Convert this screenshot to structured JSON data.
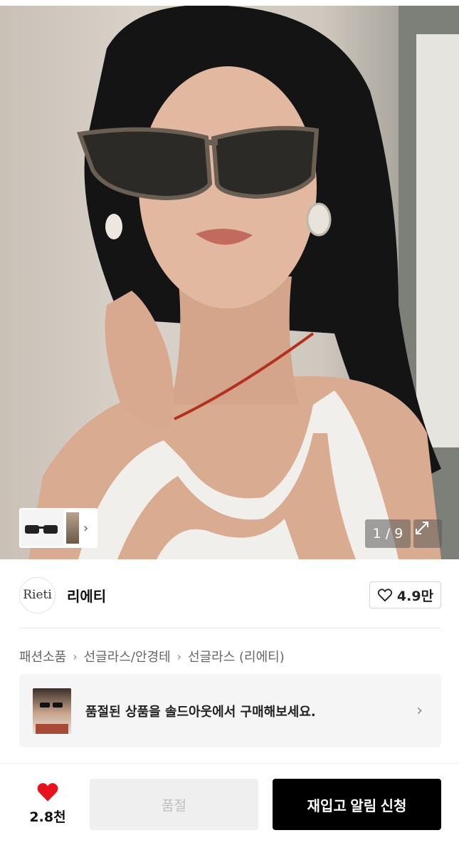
{
  "gallery": {
    "counter": "1 / 9"
  },
  "brand": {
    "logo_text": "Rieti",
    "name": "리에티",
    "like_count": "4.9만"
  },
  "breadcrumb": [
    "패션소품",
    "선글라스/안경테",
    "선글라스 (리에티)"
  ],
  "soldout_banner": {
    "text": "품절된 상품을 솔드아웃에서 구매해보세요."
  },
  "bottom_bar": {
    "wish_count": "2.8천",
    "soldout_label": "품절",
    "restock_label": "재입고 알림 신청"
  },
  "colors": {
    "accent_heart": "#e8121c",
    "primary_button": "#000000"
  }
}
